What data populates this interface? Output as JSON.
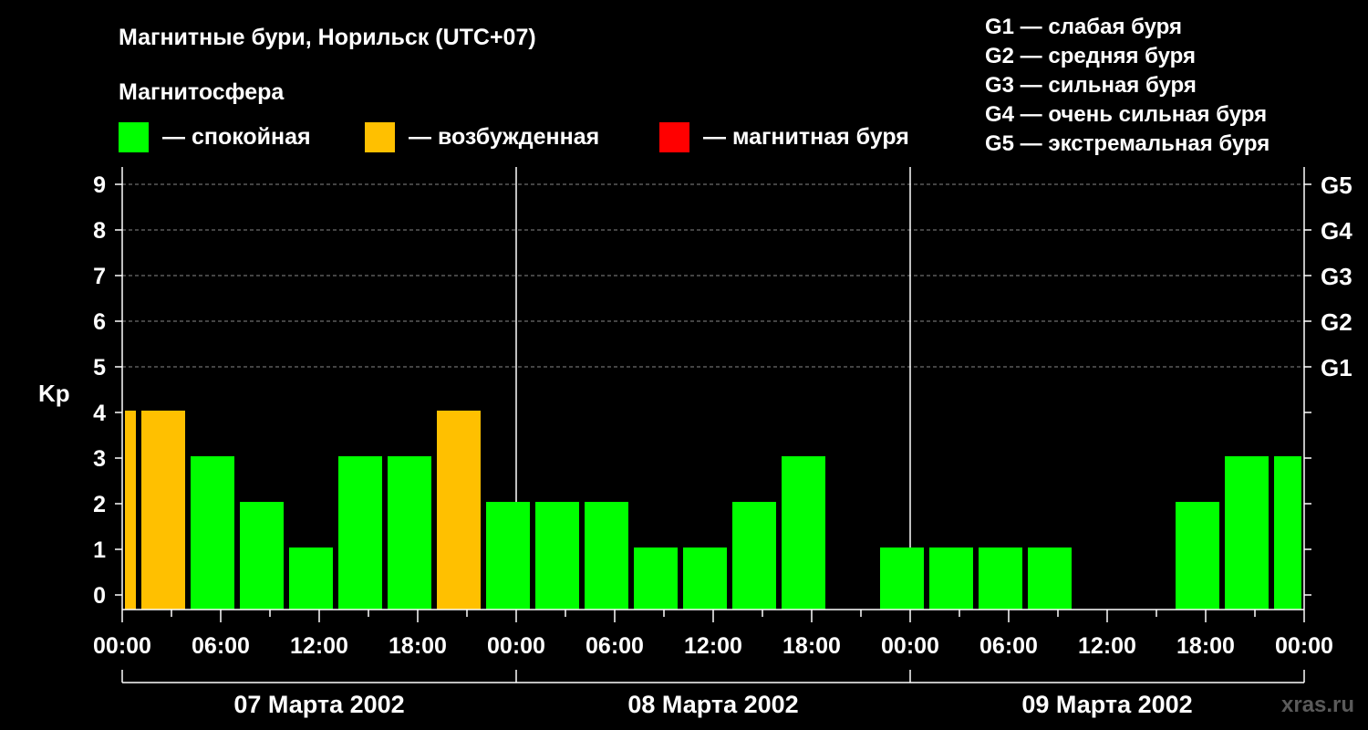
{
  "chart_data": {
    "type": "bar",
    "title": "Магнитные бури, Норильск (UTC+07)",
    "subtitle": "Магнитосфера",
    "ylabel": "Kp",
    "ylim": [
      0,
      9
    ],
    "yticks": [
      "0",
      "1",
      "2",
      "3",
      "4",
      "5",
      "6",
      "7",
      "8",
      "9"
    ],
    "storm_scale": [
      {
        "label": "G1",
        "kp": 5
      },
      {
        "label": "G2",
        "kp": 6
      },
      {
        "label": "G3",
        "kp": 7
      },
      {
        "label": "G4",
        "kp": 8
      },
      {
        "label": "G5",
        "kp": 9
      }
    ],
    "storm_legend": [
      "G1 — слабая буря",
      "G2 — средняя буря",
      "G3 — сильная буря",
      "G4 — очень сильная буря",
      "G5 — экстремальная буря"
    ],
    "legend": [
      {
        "label": "— спокойная",
        "color": "#00ff00"
      },
      {
        "label": "— возбужденная",
        "color": "#ffc000"
      },
      {
        "label": "— магнитная буря",
        "color": "#ff0000"
      }
    ],
    "xticks": [
      "00:00",
      "06:00",
      "12:00",
      "18:00",
      "00:00",
      "06:00",
      "12:00",
      "18:00",
      "00:00",
      "06:00",
      "12:00",
      "18:00",
      "00:00"
    ],
    "days": [
      "07 Марта 2002",
      "08 Марта 2002",
      "09 Марта 2002"
    ],
    "bars": [
      {
        "start_h": 0,
        "end_h": 1,
        "kp": 4,
        "level": "excited"
      },
      {
        "start_h": 1,
        "end_h": 4,
        "kp": 4,
        "level": "excited"
      },
      {
        "start_h": 4,
        "end_h": 7,
        "kp": 3,
        "level": "quiet"
      },
      {
        "start_h": 7,
        "end_h": 10,
        "kp": 2,
        "level": "quiet"
      },
      {
        "start_h": 10,
        "end_h": 13,
        "kp": 1,
        "level": "quiet"
      },
      {
        "start_h": 13,
        "end_h": 16,
        "kp": 3,
        "level": "quiet"
      },
      {
        "start_h": 16,
        "end_h": 19,
        "kp": 3,
        "level": "quiet"
      },
      {
        "start_h": 19,
        "end_h": 22,
        "kp": 4,
        "level": "excited"
      },
      {
        "start_h": 22,
        "end_h": 25,
        "kp": 2,
        "level": "quiet"
      },
      {
        "start_h": 25,
        "end_h": 28,
        "kp": 2,
        "level": "quiet"
      },
      {
        "start_h": 28,
        "end_h": 31,
        "kp": 2,
        "level": "quiet"
      },
      {
        "start_h": 31,
        "end_h": 34,
        "kp": 1,
        "level": "quiet"
      },
      {
        "start_h": 34,
        "end_h": 37,
        "kp": 1,
        "level": "quiet"
      },
      {
        "start_h": 37,
        "end_h": 40,
        "kp": 2,
        "level": "quiet"
      },
      {
        "start_h": 40,
        "end_h": 43,
        "kp": 3,
        "level": "quiet"
      },
      {
        "start_h": 43,
        "end_h": 46,
        "kp": 0,
        "level": "quiet"
      },
      {
        "start_h": 46,
        "end_h": 49,
        "kp": 1,
        "level": "quiet"
      },
      {
        "start_h": 49,
        "end_h": 52,
        "kp": 1,
        "level": "quiet"
      },
      {
        "start_h": 52,
        "end_h": 55,
        "kp": 1,
        "level": "quiet"
      },
      {
        "start_h": 55,
        "end_h": 58,
        "kp": 1,
        "level": "quiet"
      },
      {
        "start_h": 58,
        "end_h": 61,
        "kp": 0,
        "level": "quiet"
      },
      {
        "start_h": 61,
        "end_h": 64,
        "kp": 0,
        "level": "quiet"
      },
      {
        "start_h": 64,
        "end_h": 67,
        "kp": 2,
        "level": "quiet"
      },
      {
        "start_h": 67,
        "end_h": 70,
        "kp": 3,
        "level": "quiet"
      },
      {
        "start_h": 70,
        "end_h": 72,
        "kp": 3,
        "level": "quiet"
      }
    ],
    "level_colors": {
      "quiet": "#00ff00",
      "excited": "#ffc000",
      "storm": "#ff0000"
    }
  },
  "watermark": "xras.ru"
}
